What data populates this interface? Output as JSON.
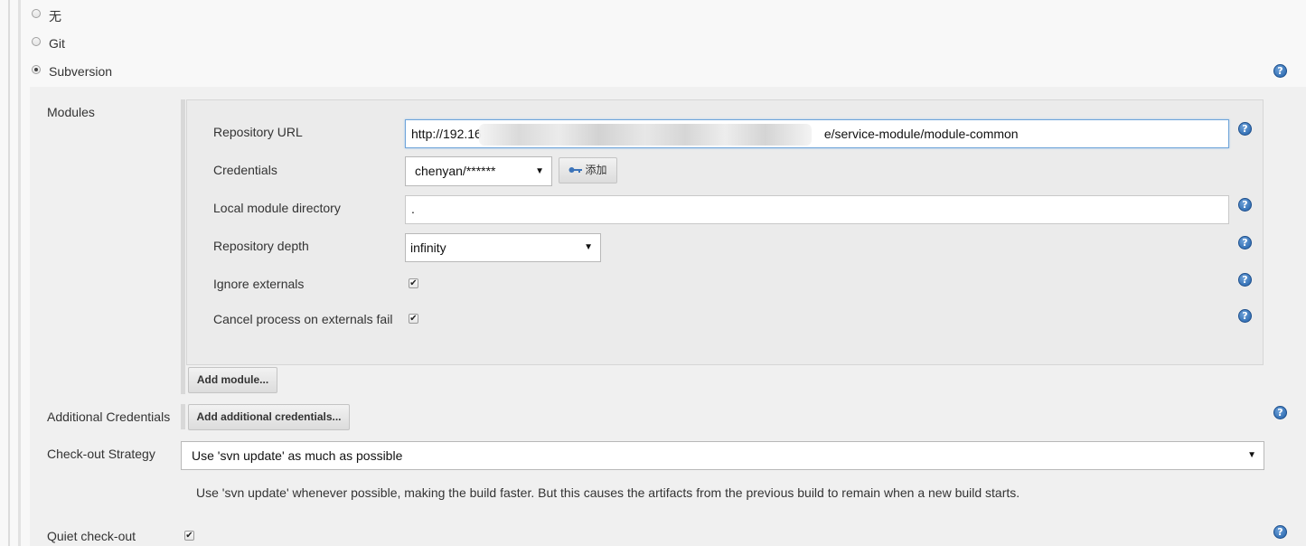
{
  "scm": {
    "options": [
      {
        "label": "无",
        "checked": false
      },
      {
        "label": "Git",
        "checked": false
      },
      {
        "label": "Subversion",
        "checked": true
      }
    ]
  },
  "modules": {
    "label": "Modules",
    "repository_url": {
      "label": "Repository URL",
      "value_prefix": "http://192.16",
      "value_suffix": "e/service-module/module-common"
    },
    "credentials": {
      "label": "Credentials",
      "selected": "chenyan/******",
      "add_label": "添加"
    },
    "local_module_directory": {
      "label": "Local module directory",
      "value": "."
    },
    "repository_depth": {
      "label": "Repository depth",
      "selected": "infinity"
    },
    "ignore_externals": {
      "label": "Ignore externals",
      "checked": true
    },
    "cancel_process": {
      "label": "Cancel process on externals fail",
      "checked": true
    },
    "add_module_label": "Add module..."
  },
  "additional_credentials": {
    "label": "Additional Credentials",
    "button_label": "Add additional credentials..."
  },
  "checkout_strategy": {
    "label": "Check-out Strategy",
    "selected": "Use 'svn update' as much as possible",
    "description": "Use 'svn update' whenever possible, making the build faster. But this causes the artifacts from the previous build to remain when a new build starts."
  },
  "quiet_checkout": {
    "label": "Quiet check-out",
    "checked": true
  },
  "help_icon_glyph": "?",
  "checkbox_glyph": "✔",
  "dropdown_glyph": "▼",
  "colors": {
    "help_icon": "#1f5fa8",
    "focus_border": "#6ea4d9"
  }
}
